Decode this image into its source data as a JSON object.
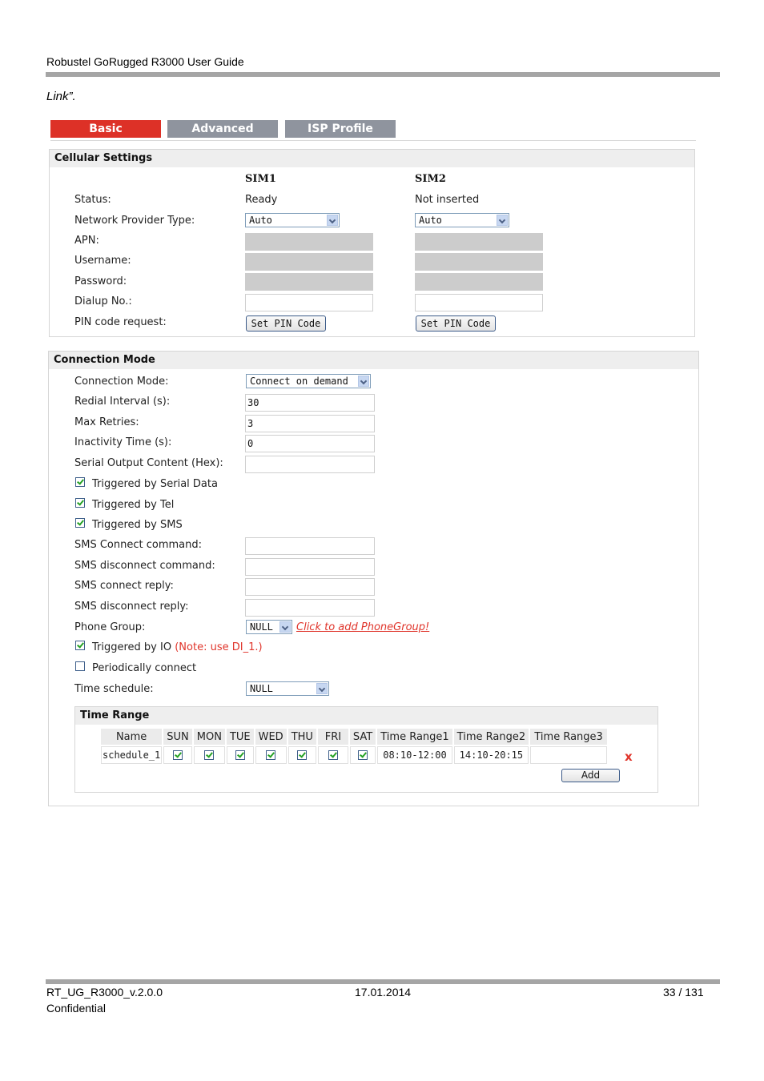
{
  "document": {
    "header_title": "Robustel GoRugged R3000 User Guide",
    "intro_text": "Link”.",
    "footer": {
      "doc_id": "RT_UG_R3000_v.2.0.0",
      "date": "17.01.2014",
      "page": "33 / 131",
      "classification": "Confidential"
    }
  },
  "tabs": [
    {
      "label": "Basic",
      "active": true
    },
    {
      "label": "Advanced",
      "active": false
    },
    {
      "label": "ISP Profile",
      "active": false
    }
  ],
  "colors": {
    "active_tab": "#dd3127",
    "inactive_tab": "#8f949e",
    "accent_red": "#e0352b"
  },
  "cellular": {
    "title": "Cellular Settings",
    "columns": [
      "SIM1",
      "SIM2"
    ],
    "labels": {
      "status": "Status:",
      "provider": "Network Provider Type:",
      "apn": "APN:",
      "username": "Username:",
      "password": "Password:",
      "dialup": "Dialup No.:",
      "pin": "PIN code request:"
    },
    "sim1": {
      "status": "Ready",
      "provider": "Auto",
      "apn": "",
      "username": "",
      "password": "",
      "dialup": "",
      "pin_button": "Set PIN Code"
    },
    "sim2": {
      "status": "Not inserted",
      "provider": "Auto",
      "apn": "",
      "username": "",
      "password": "",
      "dialup": "",
      "pin_button": "Set PIN Code"
    }
  },
  "connection": {
    "title": "Connection Mode",
    "labels": {
      "mode": "Connection Mode:",
      "redial": "Redial Interval (s):",
      "retries": "Max Retries:",
      "inactivity": "Inactivity Time (s):",
      "serial_output": "Serial Output Content (Hex):",
      "sms_connect_cmd": "SMS Connect command:",
      "sms_disconnect_cmd": "SMS disconnect command:",
      "sms_connect_reply": "SMS connect reply:",
      "sms_disconnect_reply": "SMS disconnect reply:",
      "phone_group": "Phone Group:",
      "time_schedule": "Time schedule:"
    },
    "values": {
      "mode": "Connect on demand",
      "redial": "30",
      "retries": "3",
      "inactivity": "0",
      "serial_output": "",
      "sms_connect_cmd": "",
      "sms_disconnect_cmd": "",
      "sms_connect_reply": "",
      "sms_disconnect_reply": "",
      "phone_group": "NULL",
      "time_schedule": "NULL"
    },
    "phone_group_link": "Click to add PhoneGroup!",
    "checkboxes": {
      "serial_data": {
        "label": "Triggered by Serial Data",
        "checked": true
      },
      "tel": {
        "label": "Triggered by Tel",
        "checked": true
      },
      "sms": {
        "label": "Triggered by SMS",
        "checked": true
      },
      "io": {
        "label": "Triggered by IO",
        "note": "(Note: use DI_1.)",
        "checked": true
      },
      "periodic": {
        "label": "Periodically connect",
        "checked": false
      }
    }
  },
  "time_range": {
    "title": "Time Range",
    "headers": [
      "Name",
      "SUN",
      "MON",
      "TUE",
      "WED",
      "THU",
      "FRI",
      "SAT",
      "Time Range1",
      "Time Range2",
      "Time Range3"
    ],
    "rows": [
      {
        "name": "schedule_1",
        "days": [
          true,
          true,
          true,
          true,
          true,
          true,
          true
        ],
        "range1": "08:10-12:00",
        "range2": "14:10-20:15",
        "range3": ""
      }
    ],
    "delete_symbol": "x",
    "add_button": "Add"
  }
}
